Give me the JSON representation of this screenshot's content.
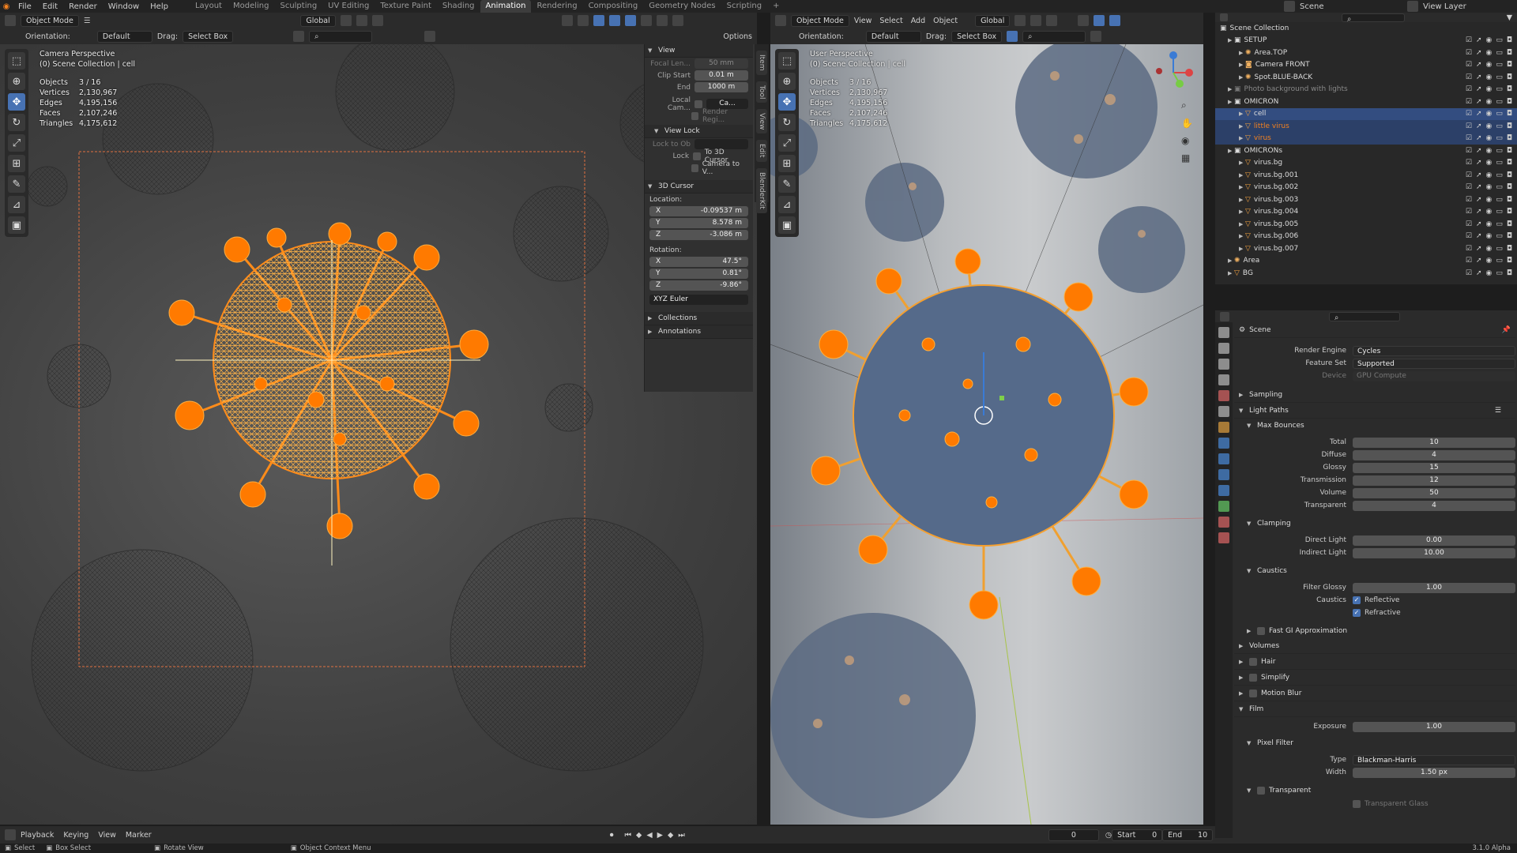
{
  "topbar": {
    "menus": [
      "File",
      "Edit",
      "Render",
      "Window",
      "Help"
    ],
    "workspaces": [
      "Layout",
      "Modeling",
      "Sculpting",
      "UV Editing",
      "Texture Paint",
      "Shading",
      "Animation",
      "Rendering",
      "Compositing",
      "Geometry Nodes",
      "Scripting",
      "+"
    ],
    "active_workspace": "Animation",
    "scene": "Scene",
    "view_layer": "View Layer"
  },
  "left_viewport": {
    "header": {
      "mode": "Object Mode",
      "transform": "Global"
    },
    "subheader": {
      "orientation_label": "Orientation:",
      "orientation": "Default",
      "drag_label": "Drag:",
      "drag": "Select Box",
      "options": "Options"
    },
    "info": {
      "line1": "Camera Perspective",
      "line2": "(0) Scene Collection | cell"
    },
    "stats": [
      {
        "k": "Objects",
        "v": "3 / 16"
      },
      {
        "k": "Vertices",
        "v": "2,130,967"
      },
      {
        "k": "Edges",
        "v": "4,195,156"
      },
      {
        "k": "Faces",
        "v": "2,107,246"
      },
      {
        "k": "Triangles",
        "v": "4,175,612"
      }
    ]
  },
  "npanel": {
    "view_title": "View",
    "focal_label": "Focal Len...",
    "focal_value": "50 mm",
    "clip_start_label": "Clip Start",
    "clip_start": "0.01 m",
    "end_label": "End",
    "end": "1000 m",
    "local_cam_label": "Local Cam...",
    "local_cam_value": "Ca...",
    "render_region": "Render Regi...",
    "view_lock_title": "View Lock",
    "lock_to_ob_label": "Lock to Ob",
    "lock_label": "Lock",
    "to_3d_cursor": "To 3D Cursor",
    "camera_to_view": "Camera to V...",
    "cursor_title": "3D Cursor",
    "location_label": "Location:",
    "loc": [
      {
        "a": "X",
        "v": "-0.09537 m"
      },
      {
        "a": "Y",
        "v": "8.578 m"
      },
      {
        "a": "Z",
        "v": "-3.086 m"
      }
    ],
    "rotation_label": "Rotation:",
    "rot": [
      {
        "a": "X",
        "v": "47.5°"
      },
      {
        "a": "Y",
        "v": "0.81°"
      },
      {
        "a": "Z",
        "v": "-9.86°"
      }
    ],
    "rot_mode": "XYZ Euler",
    "collections": "Collections",
    "annotations": "Annotations",
    "tabs": [
      "Item",
      "Tool",
      "View",
      "Edit",
      "BlenderKit"
    ]
  },
  "right_viewport": {
    "header": {
      "mode": "Object Mode",
      "menus": [
        "View",
        "Select",
        "Add",
        "Object"
      ],
      "transform": "Global"
    },
    "subheader": {
      "orientation_label": "Orientation:",
      "orientation": "Default",
      "drag_label": "Drag:",
      "drag": "Select Box"
    },
    "info": {
      "line1": "User Perspective",
      "line2": "(0) Scene Collection | cell"
    },
    "stats": [
      {
        "k": "Objects",
        "v": "3 / 16"
      },
      {
        "k": "Vertices",
        "v": "2,130,967"
      },
      {
        "k": "Edges",
        "v": "4,195,156"
      },
      {
        "k": "Faces",
        "v": "2,107,246"
      },
      {
        "k": "Triangles",
        "v": "4,175,612"
      }
    ]
  },
  "outliner": {
    "root": "Scene Collection",
    "rows": [
      {
        "depth": 0,
        "name": "SETUP",
        "type": "coll",
        "sel": ""
      },
      {
        "depth": 1,
        "name": "Area.TOP",
        "type": "light",
        "sel": ""
      },
      {
        "depth": 1,
        "name": "Camera FRONT",
        "type": "cam",
        "sel": ""
      },
      {
        "depth": 1,
        "name": "Spot.BLUE-BACK",
        "type": "light",
        "sel": ""
      },
      {
        "depth": 0,
        "name": "Photo background with lights",
        "type": "coll-dim",
        "sel": ""
      },
      {
        "depth": 0,
        "name": "OMICRON",
        "type": "coll",
        "sel": ""
      },
      {
        "depth": 1,
        "name": "cell",
        "type": "mesh",
        "sel": "active"
      },
      {
        "depth": 1,
        "name": "little virus",
        "type": "mesh",
        "sel": "sel"
      },
      {
        "depth": 1,
        "name": "virus",
        "type": "mesh",
        "sel": "sel"
      },
      {
        "depth": 0,
        "name": "OMICRONs",
        "type": "coll",
        "sel": ""
      },
      {
        "depth": 1,
        "name": "virus.bg",
        "type": "mesh",
        "sel": ""
      },
      {
        "depth": 1,
        "name": "virus.bg.001",
        "type": "mesh",
        "sel": ""
      },
      {
        "depth": 1,
        "name": "virus.bg.002",
        "type": "mesh",
        "sel": ""
      },
      {
        "depth": 1,
        "name": "virus.bg.003",
        "type": "mesh",
        "sel": ""
      },
      {
        "depth": 1,
        "name": "virus.bg.004",
        "type": "mesh",
        "sel": ""
      },
      {
        "depth": 1,
        "name": "virus.bg.005",
        "type": "mesh",
        "sel": ""
      },
      {
        "depth": 1,
        "name": "virus.bg.006",
        "type": "mesh",
        "sel": ""
      },
      {
        "depth": 1,
        "name": "virus.bg.007",
        "type": "mesh",
        "sel": ""
      },
      {
        "depth": 0,
        "name": "Area",
        "type": "light",
        "sel": ""
      },
      {
        "depth": 0,
        "name": "BG",
        "type": "mesh",
        "sel": ""
      }
    ]
  },
  "properties": {
    "context": "Scene",
    "render_engine_label": "Render Engine",
    "render_engine": "Cycles",
    "feature_set_label": "Feature Set",
    "feature_set": "Supported",
    "device_label": "Device",
    "device": "GPU Compute",
    "sampling": "Sampling",
    "light_paths": "Light Paths",
    "max_bounces": "Max Bounces",
    "bounces": [
      {
        "k": "Total",
        "v": "10"
      },
      {
        "k": "Diffuse",
        "v": "4"
      },
      {
        "k": "Glossy",
        "v": "15"
      },
      {
        "k": "Transmission",
        "v": "12"
      },
      {
        "k": "Volume",
        "v": "50"
      },
      {
        "k": "Transparent",
        "v": "4"
      }
    ],
    "clamping": "Clamping",
    "direct_light_label": "Direct Light",
    "direct_light": "0.00",
    "indirect_light_label": "Indirect Light",
    "indirect_light": "10.00",
    "caustics": "Caustics",
    "filter_glossy_label": "Filter Glossy",
    "filter_glossy": "1.00",
    "caustics_label": "Caustics",
    "reflective": "Reflective",
    "refractive": "Refractive",
    "sampling2": "Sampling",
    "fast_gi": "Fast GI Approximation",
    "volumes": "Volumes",
    "hair": "Hair",
    "simplify": "Simplify",
    "motion_blur": "Motion Blur",
    "film": "Film",
    "exposure_label": "Exposure",
    "exposure": "1.00",
    "pixel_filter": "Pixel Filter",
    "type_label": "Type",
    "type": "Blackman-Harris",
    "width_label": "Width",
    "width": "1.50 px",
    "transparent": "Transparent",
    "transparent_glass": "Transparent Glass"
  },
  "timeline": {
    "menus": [
      "Playback",
      "Keying",
      "View",
      "Marker"
    ],
    "frame": "0",
    "start_label": "Start",
    "start": "0",
    "end_label": "End",
    "end": "10"
  },
  "statusbar": {
    "select": "Select",
    "box_select": "Box Select",
    "rotate_view": "Rotate View",
    "context_menu": "Object Context Menu",
    "version": "3.1.0 Alpha"
  },
  "colors": {
    "accent": "#4772b3",
    "selection": "#f5821f",
    "outliner_sel": "#334d80"
  }
}
